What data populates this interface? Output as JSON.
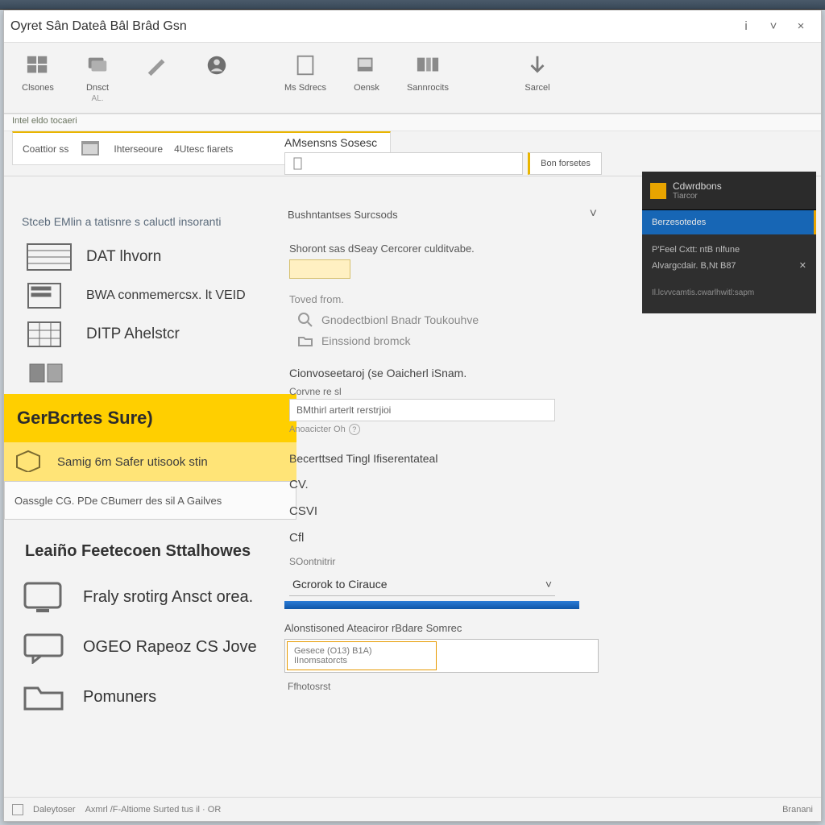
{
  "window": {
    "title": "Oyret Sân Dateâ Bâl Brâd Gsn"
  },
  "winbuttons": {
    "min": "–",
    "max": "□",
    "close": "×",
    "help": "i"
  },
  "ribbon": [
    {
      "label": "Clsones",
      "sub": ""
    },
    {
      "label": "Dnsct",
      "sub": "AL."
    },
    {
      "label": "",
      "sub": ""
    },
    {
      "label": "",
      "sub": ""
    },
    {
      "label": "Ms Sdrecs",
      "sub": ""
    },
    {
      "label": "Oensk",
      "sub": ""
    },
    {
      "label": "Sannrocits",
      "sub": ""
    },
    {
      "label": "Sarcel",
      "sub": ""
    }
  ],
  "crumb": "Intel eldo tocaeri",
  "tabs": {
    "a": "Coattior ss",
    "b": "Ihterseoure",
    "c": "4Utesc fiarets",
    "panel_title": "AMsensns Sosesc",
    "search_placeholder": "",
    "button": "Bon forsetes"
  },
  "expand": {
    "label": "Bushntantses Surcsods"
  },
  "left": {
    "section": "Stceb EMlin a tatisnre s caluctl insoranti",
    "items": [
      "DAT lhvorn",
      "BWA conmemercsx. lt VEID",
      "DITP Ahelstcr"
    ],
    "hl_main": "GerBcrtes Sure)",
    "hl_sub": "Samig 6m Safer utisook stin",
    "hl_box": "Oassgle CG. PDe CBumerr des sil A Gailves",
    "section2": "Leaiño Feetecoen Sttalhowes",
    "items2": [
      "Fraly srotirg Ansct orea.",
      "OGEO Rapeoz CS Jove",
      "Pomuners"
    ]
  },
  "mid": {
    "label1": "Shoront sas dSeay Cercorer culditvabe.",
    "group_grey": "Toved from.",
    "row_search": "Gnodectbionl Bnadr Toukouhve",
    "row_folder": "Einssiond bromck",
    "head2": "Cionvoseetaroj (se Oaicherl iSnam.",
    "input_label": "Corvne re sl",
    "input_value": "BMthirl arterlt rerstrjioi",
    "input_hint": "Anoacicter Oh",
    "sec_label": "Becerttsed Tingl Ifiserentateal",
    "p1": "CV.",
    "p2": "CSVI",
    "p3": "Cfl",
    "drop_label": "SOontnitrir",
    "drop_value": "Gcrorok to Cirauce",
    "sec2": "Alonstisoned Ateaciror rBdare Somrec",
    "orange_a": "Gesece (O13) B1A)",
    "orange_b": "IInomsatorcts",
    "foot": "Ffhotosrst"
  },
  "footer": {
    "a": "Daleytoser",
    "b": "Axmrl /F-Altiome Surted tus il · OR",
    "c": "Branani"
  },
  "dark": {
    "t1": "Cdwrdbons",
    "t2": "Tiarcor",
    "sel": "Berzesotedes",
    "r1": "P'Feel Cxtt: ntB nlfune",
    "r2a": "Alvargcdair. B,Nt B87",
    "r2b": "✕",
    "r3": "Il.lcvvcamtis.cwarlhwitl:sapm"
  }
}
